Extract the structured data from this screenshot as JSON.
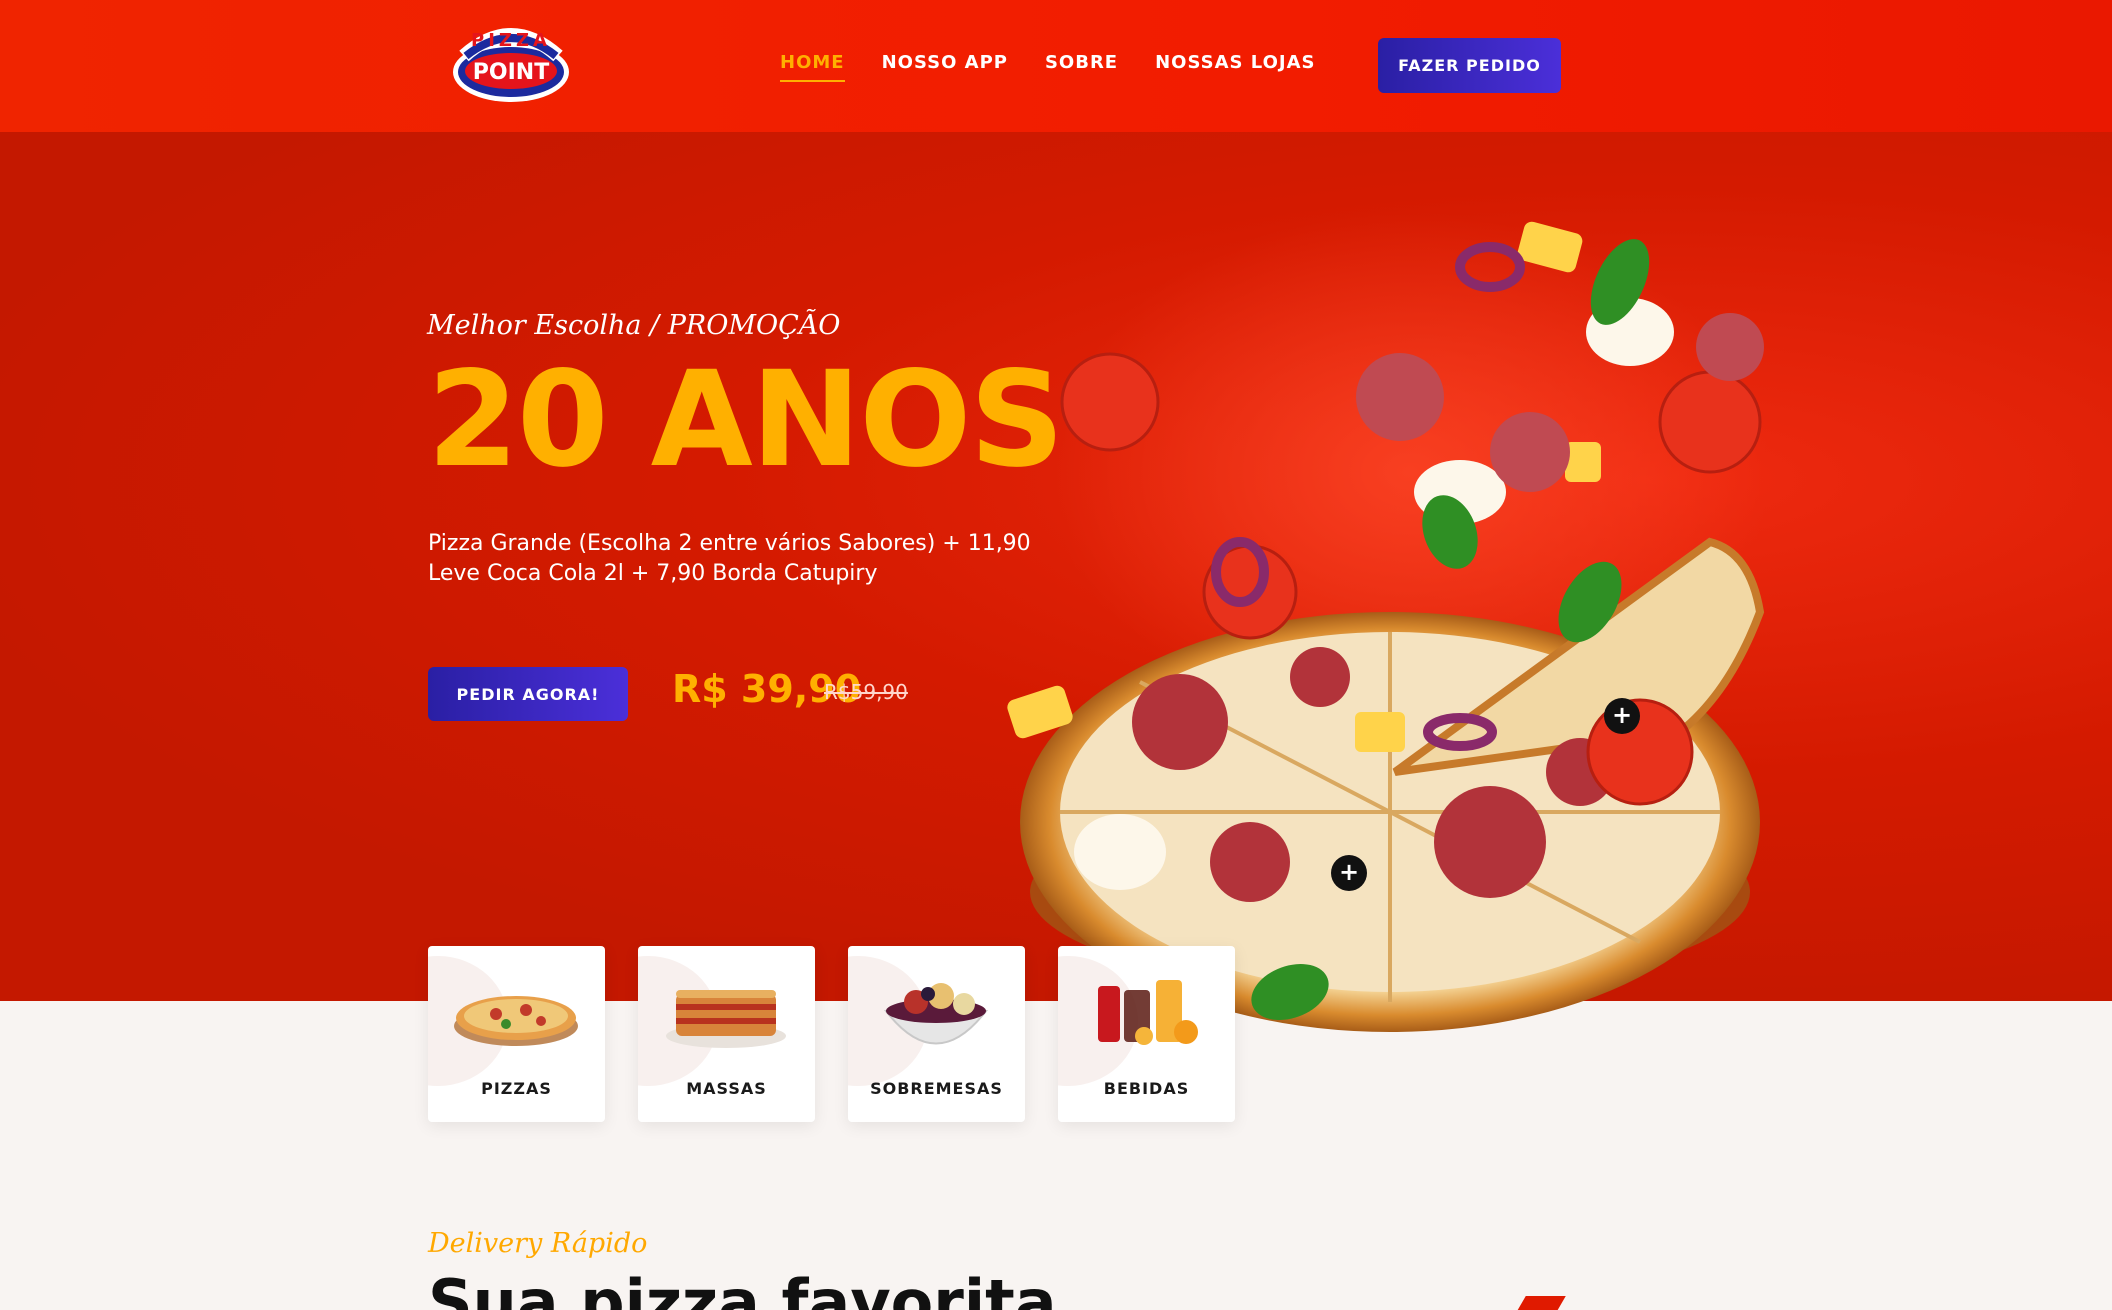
{
  "header": {
    "logo_top": "PIZZA",
    "logo_main": "POINT",
    "nav": [
      {
        "label": "HOME",
        "active": true
      },
      {
        "label": "NOSSO APP",
        "active": false
      },
      {
        "label": "SOBRE",
        "active": false
      },
      {
        "label": "NOSSAS LOJAS",
        "active": false
      }
    ],
    "order_button": "FAZER PEDIDO"
  },
  "hero": {
    "tagline": "Melhor Escolha / PROMOÇÃO",
    "title": "20 ANOS",
    "description": "Pizza Grande (Escolha 2 entre vários Sabores) + 11,90 Leve Coca Cola 2l + 7,90 Borda Catupiry",
    "cta_button": "PEDIR AGORA!",
    "price": "R$ 39,90",
    "old_price": "R$59,90",
    "hotspot_symbol": "+"
  },
  "categories": [
    {
      "label": "PIZZAS",
      "icon": "pizza-icon"
    },
    {
      "label": "MASSAS",
      "icon": "lasagna-icon"
    },
    {
      "label": "SOBREMESAS",
      "icon": "dessert-bowl-icon"
    },
    {
      "label": "BEBIDAS",
      "icon": "drinks-icon"
    }
  ],
  "delivery": {
    "tagline": "Delivery Rápido",
    "title": "Sua pizza favorita"
  },
  "colors": {
    "header_red": "#f01e00",
    "hero_red": "#c41800",
    "accent_yellow": "#ffb000",
    "button_blue": "#2a1fa4",
    "section_bg": "#f8f4f2"
  }
}
